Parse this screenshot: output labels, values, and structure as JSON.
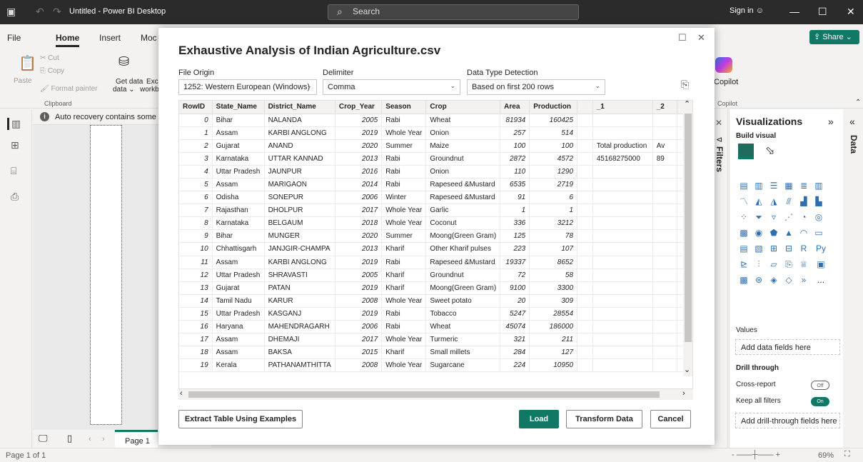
{
  "titlebar": {
    "title": "Untitled - Power BI Desktop",
    "search": "Search",
    "sign_in": "Sign in"
  },
  "ribbon": {
    "tabs": [
      "File",
      "Home",
      "Insert",
      "Moc"
    ],
    "share": "Share",
    "paste": "Paste",
    "cut": "Cut",
    "copy": "Copy",
    "format_painter": "Format painter",
    "get_data": "Get data",
    "get_data_2": "data",
    "excel": "Exc",
    "excel_2": "workb",
    "clipboard": "Clipboard",
    "copilot": "Copilot",
    "copilot_group": "Copilot"
  },
  "notice": "Auto recovery contains some re",
  "pages": {
    "tab": "Page 1",
    "status": "Page 1 of 1",
    "zoom": "69%"
  },
  "filters_label": "Filters",
  "data_label": "Data",
  "viz": {
    "title": "Visualizations",
    "build": "Build visual",
    "values": "Values",
    "add_fields": "Add data fields here",
    "drill": "Drill through",
    "cross": "Cross-report",
    "cross_state": "Off",
    "keep": "Keep all filters",
    "keep_state": "On",
    "add_drill": "Add drill-through fields here",
    "more": "..."
  },
  "dialog": {
    "title": "Exhaustive Analysis of Indian Agriculture.csv",
    "file_origin_label": "File Origin",
    "file_origin": "1252: Western European (Windows)",
    "delimiter_label": "Delimiter",
    "delimiter": "Comma",
    "detect_label": "Data Type Detection",
    "detect": "Based on first 200 rows",
    "columns": [
      "RowID",
      "State_Name",
      "District_Name",
      "Crop_Year",
      "Season",
      "Crop",
      "Area",
      "Production",
      "",
      "_1",
      "_2",
      ""
    ],
    "rows": [
      [
        "0",
        "Bihar",
        "NALANDA",
        "2005",
        "Rabi",
        "Wheat",
        "81934",
        "160425",
        "",
        "",
        ""
      ],
      [
        "1",
        "Assam",
        "KARBI ANGLONG",
        "2019",
        "Whole Year",
        "Onion",
        "257",
        "514",
        "",
        "",
        ""
      ],
      [
        "2",
        "Gujarat",
        "ANAND",
        "2020",
        "Summer",
        "Maize",
        "100",
        "100",
        "",
        "Total production",
        "Av"
      ],
      [
        "3",
        "Karnataka",
        "UTTAR KANNAD",
        "2013",
        "Rabi",
        "Groundnut",
        "2872",
        "4572",
        "",
        "45168275000",
        "89"
      ],
      [
        "4",
        "Uttar Pradesh",
        "JAUNPUR",
        "2016",
        "Rabi",
        "Onion",
        "110",
        "1290",
        "",
        "",
        ""
      ],
      [
        "5",
        "Assam",
        "MARIGAON",
        "2014",
        "Rabi",
        "Rapeseed &Mustard",
        "6535",
        "2719",
        "",
        "",
        ""
      ],
      [
        "6",
        "Odisha",
        "SONEPUR",
        "2006",
        "Winter",
        "Rapeseed &Mustard",
        "91",
        "6",
        "",
        "",
        ""
      ],
      [
        "7",
        "Rajasthan",
        "DHOLPUR",
        "2017",
        "Whole Year",
        "Garlic",
        "1",
        "1",
        "",
        "",
        ""
      ],
      [
        "8",
        "Karnataka",
        "BELGAUM",
        "2018",
        "Whole Year",
        "Coconut",
        "336",
        "3212",
        "",
        "",
        ""
      ],
      [
        "9",
        "Bihar",
        "MUNGER",
        "2020",
        "Summer",
        "Moong(Green Gram)",
        "125",
        "78",
        "",
        "",
        ""
      ],
      [
        "10",
        "Chhattisgarh",
        "JANJGIR-CHAMPA",
        "2013",
        "Kharif",
        "Other Kharif pulses",
        "223",
        "107",
        "",
        "",
        ""
      ],
      [
        "11",
        "Assam",
        "KARBI ANGLONG",
        "2019",
        "Rabi",
        "Rapeseed &Mustard",
        "19337",
        "8652",
        "",
        "",
        ""
      ],
      [
        "12",
        "Uttar Pradesh",
        "SHRAVASTI",
        "2005",
        "Kharif",
        "Groundnut",
        "72",
        "58",
        "",
        "",
        ""
      ],
      [
        "13",
        "Gujarat",
        "PATAN",
        "2019",
        "Kharif",
        "Moong(Green Gram)",
        "9100",
        "3300",
        "",
        "",
        ""
      ],
      [
        "14",
        "Tamil Nadu",
        "KARUR",
        "2008",
        "Whole Year",
        "Sweet potato",
        "20",
        "309",
        "",
        "",
        ""
      ],
      [
        "15",
        "Uttar Pradesh",
        "KASGANJ",
        "2019",
        "Rabi",
        "Tobacco",
        "5247",
        "28554",
        "",
        "",
        ""
      ],
      [
        "16",
        "Haryana",
        "MAHENDRAGARH",
        "2006",
        "Rabi",
        "Wheat",
        "45074",
        "186000",
        "",
        "",
        ""
      ],
      [
        "17",
        "Assam",
        "DHEMAJI",
        "2017",
        "Whole Year",
        "Turmeric",
        "321",
        "211",
        "",
        "",
        ""
      ],
      [
        "18",
        "Assam",
        "BAKSA",
        "2015",
        "Kharif",
        "Small millets",
        "284",
        "127",
        "",
        "",
        ""
      ],
      [
        "19",
        "Kerala",
        "PATHANAMTHITTA",
        "2008",
        "Whole Year",
        "Sugarcane",
        "224",
        "10950",
        "",
        "",
        ""
      ]
    ],
    "extract": "Extract Table Using Examples",
    "load": "Load",
    "transform": "Transform Data",
    "cancel": "Cancel"
  }
}
